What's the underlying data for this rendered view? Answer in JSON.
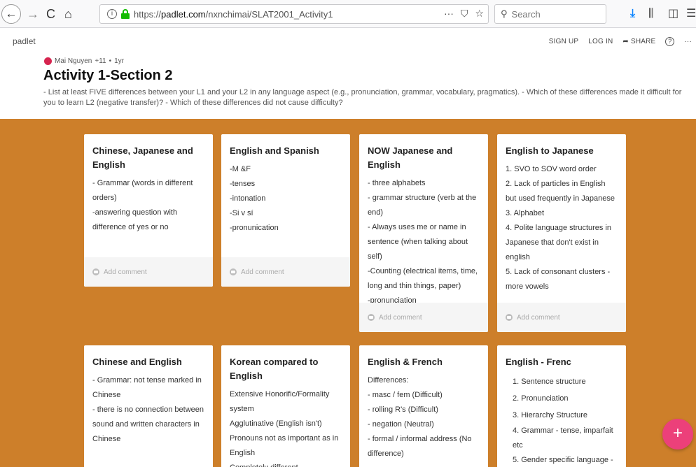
{
  "browser": {
    "back": "←",
    "forward": "→",
    "reload": "C",
    "home": "⌂",
    "url_prefix": "https://",
    "url_host": "padlet.com",
    "url_path": "/nxnchimai/SLAT2001_Activity1",
    "url_more": "···",
    "search_placeholder": "Search"
  },
  "header": {
    "brand": "padlet",
    "links": [
      "SIGN UP",
      "LOG IN",
      "SHARE"
    ],
    "more": "···"
  },
  "author": {
    "name": "Mai Nguyen",
    "score": "+11",
    "dot": "•",
    "age": "1yr"
  },
  "page": {
    "title": "Activity 1-Section 2",
    "description": "- List at least FIVE differences between your L1 and your L2 in any language aspect (e.g., pronunciation, grammar, vocabulary, pragmatics). - Which of these differences made it difficult for you to learn L2 (negative transfer)? - Which of these differences did not cause difficulty?"
  },
  "cards": [
    {
      "title": "Chinese, Japanese and English",
      "lines": [
        "- Grammar (words in different orders)",
        "-answering question with difference of yes or no"
      ],
      "comment": "Add comment"
    },
    {
      "title": "English and Spanish",
      "lines": [
        "-M &F",
        "-tenses",
        "-intonation",
        "-Si v sí",
        "-pronunication"
      ],
      "comment": "Add comment"
    },
    {
      "title": "NOW Japanese and English",
      "lines": [
        "- three alphabets",
        "- grammar structure (verb at the end)",
        "- Always uses me or name in sentence (when talking about self)",
        "-Counting (electrical items, time, long and thin things, paper)",
        "-pronunciation"
      ],
      "comment": "Add comment"
    },
    {
      "title": "English to Japanese",
      "lines": [
        "1. SVO to SOV word order",
        "2. Lack of particles in English but used frequently in Japanese",
        "3. Alphabet",
        "4. Polite language structures in Japanese that don't exist in english",
        "5. Lack of consonant clusters - more vowels"
      ],
      "comment": "Add comment"
    },
    {
      "title": "Chinese and English",
      "lines": [
        "- Grammar: not tense marked in Chinese",
        "- there is no connection between sound and written characters in Chinese"
      ]
    },
    {
      "title": "Korean compared to English",
      "lines": [
        "Extensive Honorific/Formality system",
        "Agglutinative (English isn't)",
        "Pronouns not as important as in English",
        "Completely different"
      ]
    },
    {
      "title": "English & French",
      "lines": [
        "Differences:",
        "- masc / fem (Difficult)",
        "- rolling R's (Difficult)",
        "- negation (Neutral)",
        "- formal / informal address (No difference)"
      ]
    },
    {
      "title": "English - Frenc",
      "lines": [
        "1. Sentence structure",
        "2. Pronunciation",
        "3. Hierarchy Structure",
        "4. Grammar - tense, imparfait etc",
        "5. Gender specific language -"
      ]
    }
  ],
  "fab": "+"
}
